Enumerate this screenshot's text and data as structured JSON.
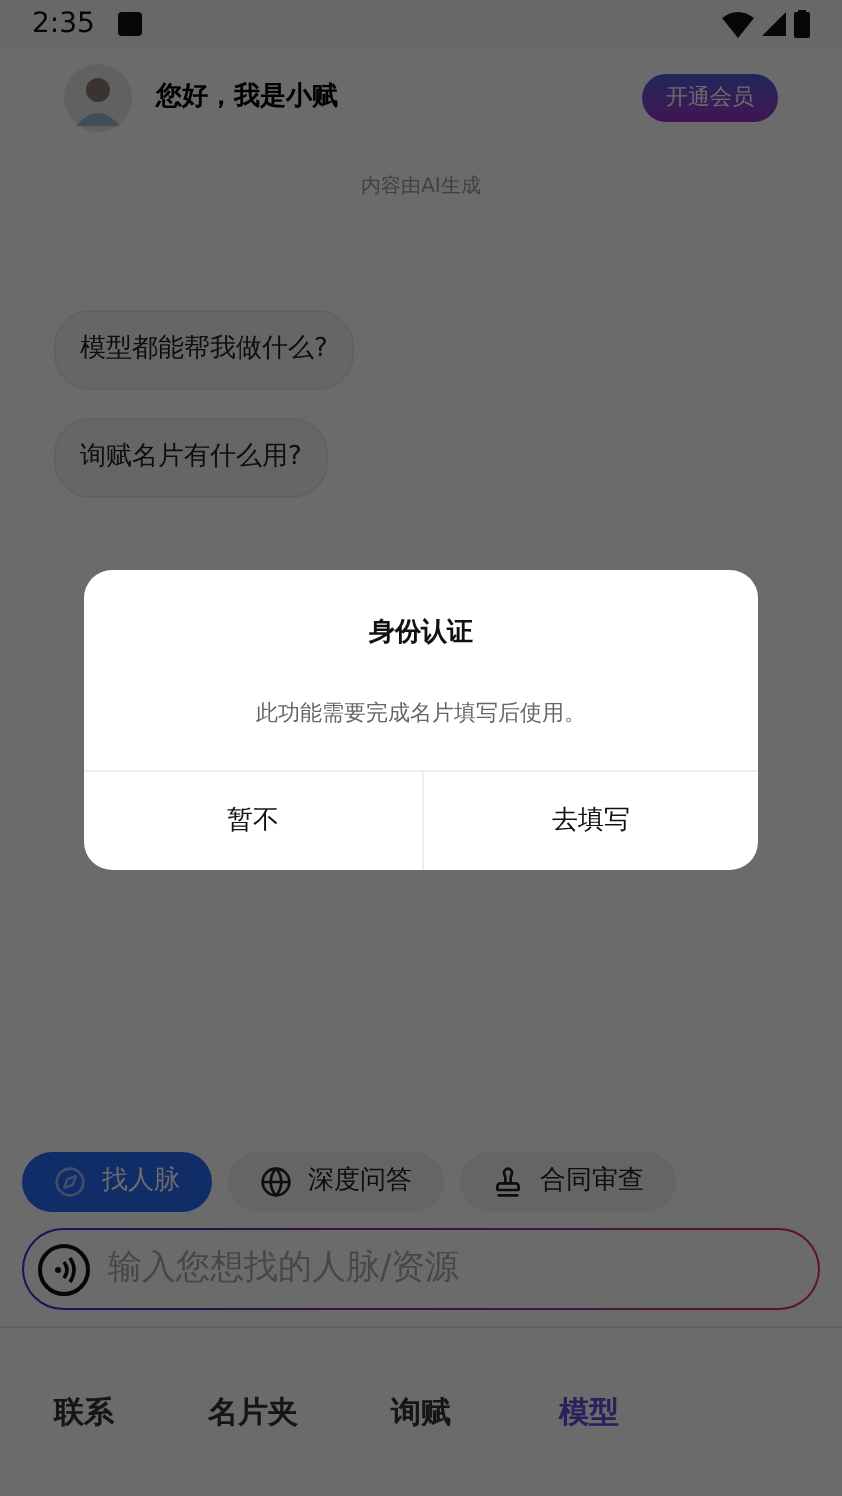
{
  "status_bar": {
    "time": "2:35"
  },
  "header": {
    "greeting": "您好，我是小赋",
    "member_button": "开通会员"
  },
  "notice": "内容由AI生成",
  "suggestions": [
    "模型都能帮我做什么?",
    "询赋名片有什么用?"
  ],
  "chips": [
    {
      "label": "找人脉",
      "kind": "compass",
      "selected": true
    },
    {
      "label": "深度问答",
      "kind": "globe",
      "selected": false
    },
    {
      "label": "合同审查",
      "kind": "stamp",
      "selected": false
    }
  ],
  "input": {
    "placeholder": "输入您想找的人脉/资源"
  },
  "nav": [
    {
      "label": "联系",
      "selected": false
    },
    {
      "label": "名片夹",
      "selected": false
    },
    {
      "label": "询赋",
      "selected": false
    },
    {
      "label": "模型",
      "selected": true
    }
  ],
  "dialog": {
    "title": "身份认证",
    "message": "此功能需要完成名片填写后使用。",
    "buttons": [
      "暂不",
      "去填写"
    ]
  }
}
